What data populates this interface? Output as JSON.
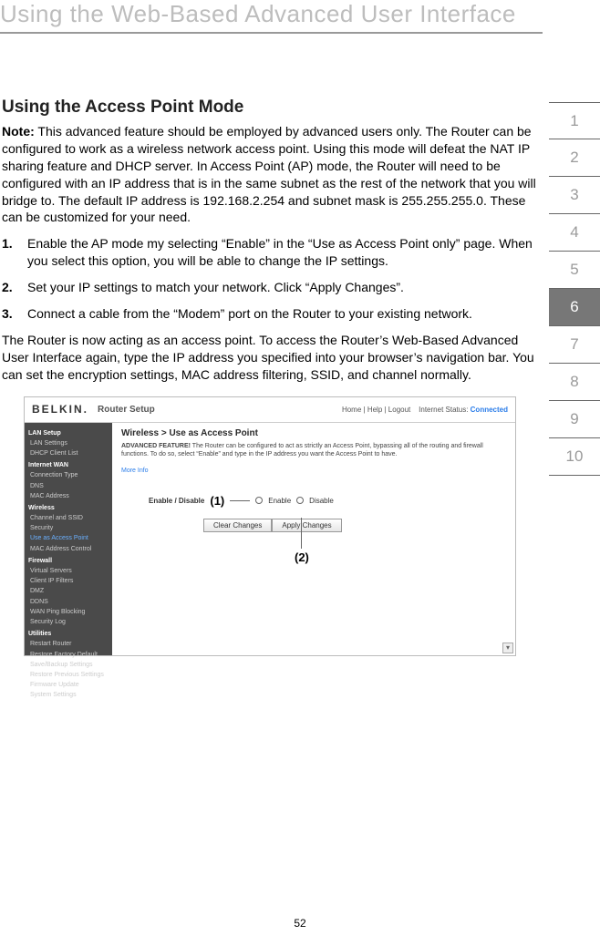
{
  "chapter_title": "Using the Web-Based Advanced User Interface",
  "section_heading": "Using the Access Point Mode",
  "note_label": "Note:",
  "note_text": "This advanced feature should be employed by advanced users only. The Router can be configured to work as a wireless network access point. Using this mode will defeat the NAT IP sharing feature and DHCP server. In Access Point (AP) mode, the Router will need to be configured with an IP address that is in the same subnet as the rest of the network that you will bridge to. The default IP address is 192.168.2.254 and subnet mask is 255.255.255.0. These can be customized for your need.",
  "steps": [
    "Enable the AP mode my selecting “Enable” in the “Use as Access Point only” page. When you select this option, you will be able to change the IP settings.",
    "Set your IP settings to match your network. Click “Apply Changes”.",
    "Connect a cable from the “Modem” port on the Router to your existing network."
  ],
  "followup": "The Router is now acting as an access point. To access the Router’s Web-Based Advanced User Interface again, type the IP address you specified into your browser’s navigation bar. You can set the encryption settings, MAC address filtering, SSID, and channel normally.",
  "side_tabs": [
    "1",
    "2",
    "3",
    "4",
    "5",
    "6",
    "7",
    "8",
    "9",
    "10"
  ],
  "active_tab_index": 5,
  "page_number": "52",
  "shot": {
    "brand": "BELKIN.",
    "brand_sub": "Router Setup",
    "status_left": "Home | Help | Logout",
    "status_label": "Internet Status:",
    "status_value": "Connected",
    "nav": {
      "groups": [
        {
          "title": "LAN Setup",
          "items": [
            "LAN Settings",
            "DHCP Client List"
          ]
        },
        {
          "title": "Internet WAN",
          "items": [
            "Connection Type",
            "DNS",
            "MAC Address"
          ]
        },
        {
          "title": "Wireless",
          "items": [
            "Channel and SSID",
            "Security",
            "Use as Access Point",
            "MAC Address Control"
          ]
        },
        {
          "title": "Firewall",
          "items": [
            "Virtual Servers",
            "Client IP Filters",
            "DMZ",
            "DDNS",
            "WAN Ping Blocking",
            "Security Log"
          ]
        },
        {
          "title": "Utilities",
          "items": [
            "Restart Router",
            "Restore Factory Default",
            "Save/Backup Settings",
            "Restore Previous Settings",
            "Firmware Update",
            "System Settings"
          ]
        }
      ],
      "selected": "Use as Access Point"
    },
    "crumb": "Wireless > Use as Access Point",
    "adv_label": "ADVANCED FEATURE!",
    "adv_text": "The Router can be configured to act as strictly an Access Point, bypassing all of the routing and firewall functions. To do so, select “Enable” and type in the IP address you want the Access Point to have.",
    "more": "More Info",
    "enable_disable_label": "Enable / Disable",
    "callout1": "(1)",
    "opt_enable": "Enable",
    "opt_disable": "Disable",
    "btn_clear": "Clear Changes",
    "btn_apply": "Apply Changes",
    "callout2": "(2)"
  }
}
